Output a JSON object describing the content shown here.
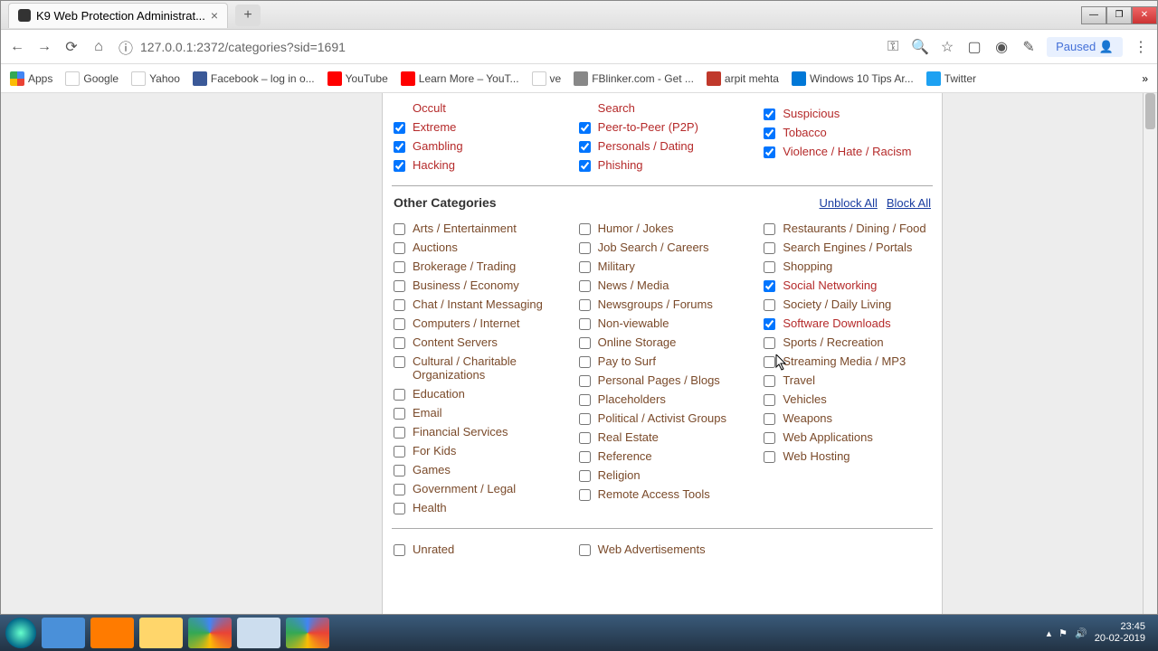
{
  "window": {
    "tab_title": "K9 Web Protection Administrat...",
    "url": "127.0.0.1:2372/categories?sid=1691",
    "paused_label": "Paused"
  },
  "bookmarks": [
    {
      "label": "Apps",
      "cls": "ico-apps"
    },
    {
      "label": "Google",
      "cls": "ico-g"
    },
    {
      "label": "Yahoo",
      "cls": "ico-y"
    },
    {
      "label": "Facebook – log in o...",
      "cls": "ico-fb"
    },
    {
      "label": "YouTube",
      "cls": "ico-yt"
    },
    {
      "label": "Learn More – YouT...",
      "cls": "ico-yt2"
    },
    {
      "label": "ve",
      "cls": "ico-doc"
    },
    {
      "label": "FBlinker.com - Get ...",
      "cls": "ico-fb2"
    },
    {
      "label": "arpit mehta",
      "cls": "ico-am"
    },
    {
      "label": "Windows 10 Tips Ar...",
      "cls": "ico-w10"
    },
    {
      "label": "Twitter",
      "cls": "ico-tw"
    }
  ],
  "top_categories": {
    "col1": [
      {
        "label": "Occult",
        "checked": false,
        "nocb": true
      },
      {
        "label": "Extreme",
        "checked": true
      },
      {
        "label": "Gambling",
        "checked": true
      },
      {
        "label": "Hacking",
        "checked": true
      }
    ],
    "col2": [
      {
        "label": "Search",
        "checked": false,
        "nocb": true
      },
      {
        "label": "Peer-to-Peer (P2P)",
        "checked": true
      },
      {
        "label": "Personals / Dating",
        "checked": true
      },
      {
        "label": "Phishing",
        "checked": true
      }
    ],
    "col3": [
      {
        "label": "",
        "checked": false,
        "nocb": true
      },
      {
        "label": "Suspicious",
        "checked": true
      },
      {
        "label": "Tobacco",
        "checked": true
      },
      {
        "label": "Violence / Hate / Racism",
        "checked": true
      }
    ]
  },
  "other_header": {
    "title": "Other Categories",
    "unblock": "Unblock All",
    "block": "Block All"
  },
  "other_categories": {
    "col1": [
      {
        "label": "Arts / Entertainment",
        "checked": false
      },
      {
        "label": "Auctions",
        "checked": false
      },
      {
        "label": "Brokerage / Trading",
        "checked": false
      },
      {
        "label": "Business / Economy",
        "checked": false
      },
      {
        "label": "Chat / Instant Messaging",
        "checked": false
      },
      {
        "label": "Computers / Internet",
        "checked": false
      },
      {
        "label": "Content Servers",
        "checked": false
      },
      {
        "label": "Cultural / Charitable Organizations",
        "checked": false
      },
      {
        "label": "Education",
        "checked": false
      },
      {
        "label": "Email",
        "checked": false
      },
      {
        "label": "Financial Services",
        "checked": false
      },
      {
        "label": "For Kids",
        "checked": false
      },
      {
        "label": "Games",
        "checked": false
      },
      {
        "label": "Government / Legal",
        "checked": false
      },
      {
        "label": "Health",
        "checked": false
      }
    ],
    "col2": [
      {
        "label": "Humor / Jokes",
        "checked": false
      },
      {
        "label": "Job Search / Careers",
        "checked": false
      },
      {
        "label": "Military",
        "checked": false
      },
      {
        "label": "News / Media",
        "checked": false
      },
      {
        "label": "Newsgroups / Forums",
        "checked": false
      },
      {
        "label": "Non-viewable",
        "checked": false
      },
      {
        "label": "Online Storage",
        "checked": false
      },
      {
        "label": "Pay to Surf",
        "checked": false
      },
      {
        "label": "Personal Pages / Blogs",
        "checked": false
      },
      {
        "label": "Placeholders",
        "checked": false
      },
      {
        "label": "Political / Activist Groups",
        "checked": false
      },
      {
        "label": "Real Estate",
        "checked": false
      },
      {
        "label": "Reference",
        "checked": false
      },
      {
        "label": "Religion",
        "checked": false
      },
      {
        "label": "Remote Access Tools",
        "checked": false
      }
    ],
    "col3": [
      {
        "label": "Restaurants / Dining / Food",
        "checked": false
      },
      {
        "label": "Search Engines / Portals",
        "checked": false
      },
      {
        "label": "Shopping",
        "checked": false
      },
      {
        "label": "Social Networking",
        "checked": true
      },
      {
        "label": "Society / Daily Living",
        "checked": false
      },
      {
        "label": "Software Downloads",
        "checked": true
      },
      {
        "label": "Sports / Recreation",
        "checked": false
      },
      {
        "label": "Streaming Media / MP3",
        "checked": false
      },
      {
        "label": "Travel",
        "checked": false
      },
      {
        "label": "Vehicles",
        "checked": false
      },
      {
        "label": "Weapons",
        "checked": false
      },
      {
        "label": "Web Applications",
        "checked": false
      },
      {
        "label": "Web Hosting",
        "checked": false
      }
    ]
  },
  "bottom_categories": {
    "col1": [
      {
        "label": "Unrated",
        "checked": false
      }
    ],
    "col2": [
      {
        "label": "Web Advertisements",
        "checked": false
      }
    ],
    "col3": []
  },
  "taskbar": {
    "time": "23:45",
    "date": "20-02-2019"
  }
}
